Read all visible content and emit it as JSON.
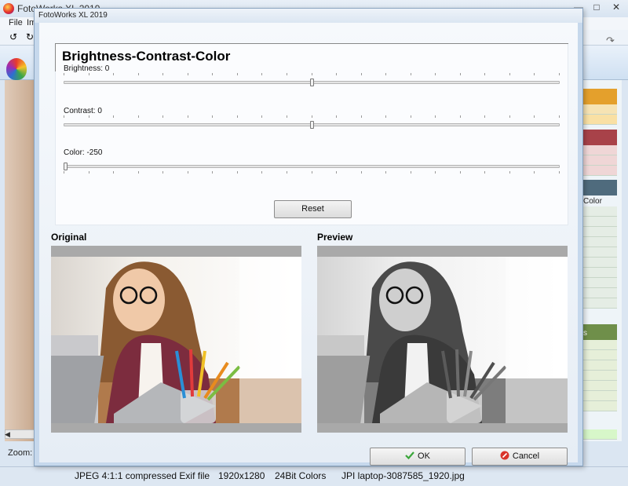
{
  "main_window": {
    "title": "FotoWorks XL 2019",
    "menu": [
      "File",
      "Im"
    ],
    "right_panel": {
      "color_label": "Color",
      "s_label": "s"
    },
    "zoom_label": "Zoom: 4",
    "colors": {
      "orange": "#e4a02c",
      "red": "#a84249",
      "slate": "#4f6b7d",
      "green": "#6f8f4a"
    }
  },
  "statusbar": {
    "format": "JPEG 4:1:1 compressed Exif file",
    "dimensions": "1920x1280",
    "color_depth": "24Bit Colors",
    "file_name": "JPI laptop-3087585_1920.jpg"
  },
  "dialog": {
    "title": "FotoWorks XL 2019",
    "heading": "Brightness-Contrast-Color",
    "sliders": [
      {
        "label": "Brightness: 0",
        "min": -250,
        "max": 250,
        "value": 0
      },
      {
        "label": "Contrast: 0",
        "min": -250,
        "max": 250,
        "value": 0
      },
      {
        "label": "Color: -250",
        "min": -250,
        "max": 250,
        "value": -250
      }
    ],
    "reset_label": "Reset",
    "original_caption": "Original",
    "preview_caption": "Preview",
    "ok_label": "OK",
    "cancel_label": "Cancel"
  }
}
